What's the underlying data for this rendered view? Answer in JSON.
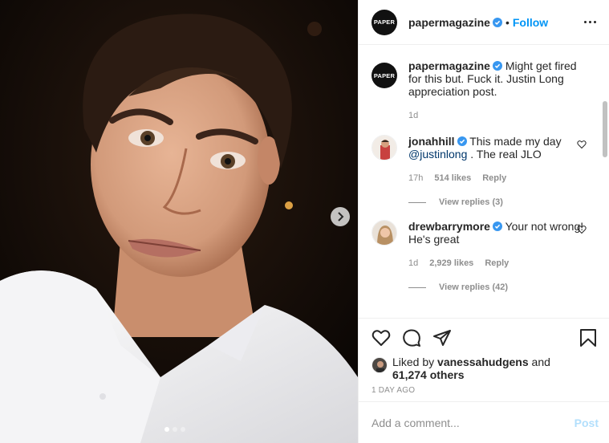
{
  "post": {
    "author": "papermagazine",
    "avatar_text": "PAPER",
    "follow_label": "Follow",
    "separator": "•"
  },
  "caption": {
    "username": "papermagazine",
    "text": "Might get fired for this but. Fuck it. Justin Long appreciation post.",
    "age": "1d"
  },
  "comments": [
    {
      "username": "jonahhill",
      "text_before": "This made my day ",
      "mention": "@justinlong",
      "text_after": " . The real JLO",
      "age": "17h",
      "likes": "514 likes",
      "reply_label": "Reply",
      "view_replies": "View replies (3)"
    },
    {
      "username": "drewbarrymore",
      "text": "Your not wrong! He's great",
      "age": "1d",
      "likes": "2,929 likes",
      "reply_label": "Reply",
      "view_replies": "View replies (42)"
    }
  ],
  "likes": {
    "prefix": "Liked by ",
    "user": "vanessahudgens",
    "middle": " and ",
    "others": "61,274 others"
  },
  "date": "1 DAY AGO",
  "add_comment": {
    "placeholder": "Add a comment...",
    "post_label": "Post"
  },
  "colors": {
    "link_blue": "#0095f6",
    "verified_blue": "#3897f0",
    "muted": "#8e8e8e",
    "post_disabled": "#b2dffc"
  },
  "icons": [
    "chevron-right-icon",
    "verified-icon",
    "more-icon",
    "heart-icon",
    "comment-icon",
    "share-icon",
    "bookmark-icon"
  ]
}
